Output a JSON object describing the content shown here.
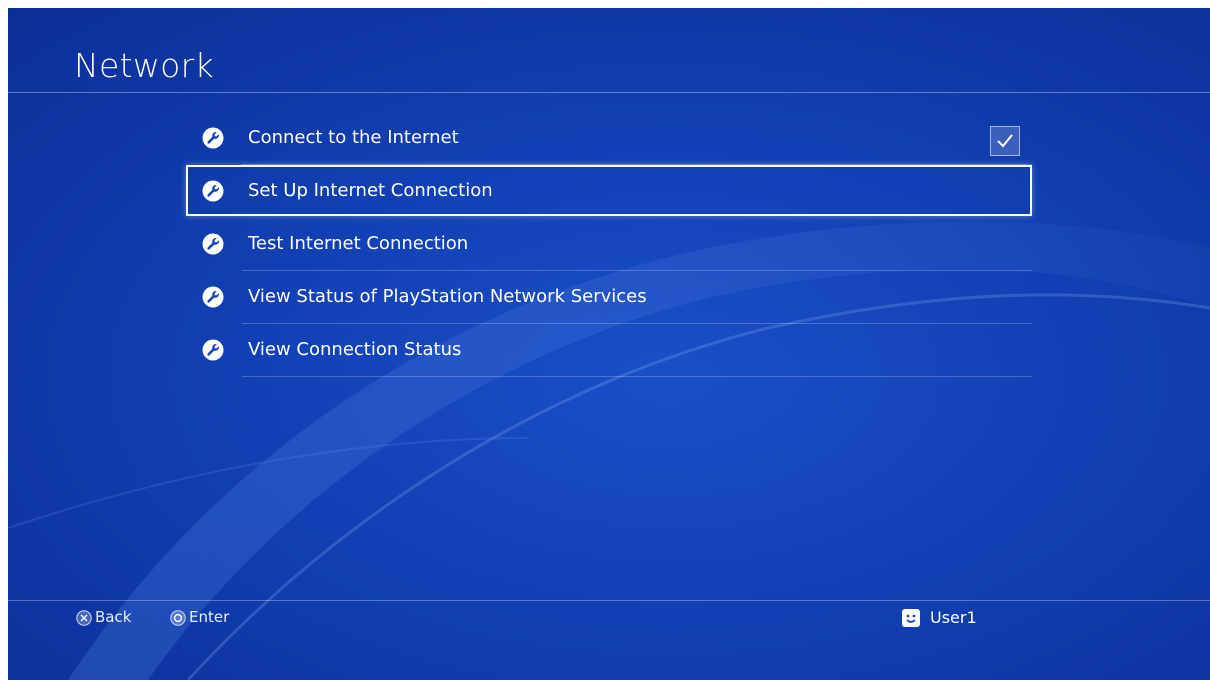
{
  "header": {
    "title": "Network"
  },
  "menu": {
    "items": [
      {
        "label": "Connect to the Internet",
        "icon": "wrench-icon",
        "checked": true
      },
      {
        "label": "Set Up Internet Connection",
        "icon": "wrench-icon",
        "selected": true
      },
      {
        "label": "Test Internet Connection",
        "icon": "wrench-icon"
      },
      {
        "label": "View Status of PlayStation Network Services",
        "icon": "wrench-icon"
      },
      {
        "label": "View Connection Status",
        "icon": "wrench-icon"
      }
    ]
  },
  "footer": {
    "back": {
      "label": "Back",
      "icon": "cross-button-icon"
    },
    "enter": {
      "label": "Enter",
      "icon": "circle-button-icon"
    },
    "user": {
      "name": "User1",
      "icon": "user-avatar-icon"
    }
  },
  "colors": {
    "background": "#1240b4",
    "text": "#ffffff"
  }
}
